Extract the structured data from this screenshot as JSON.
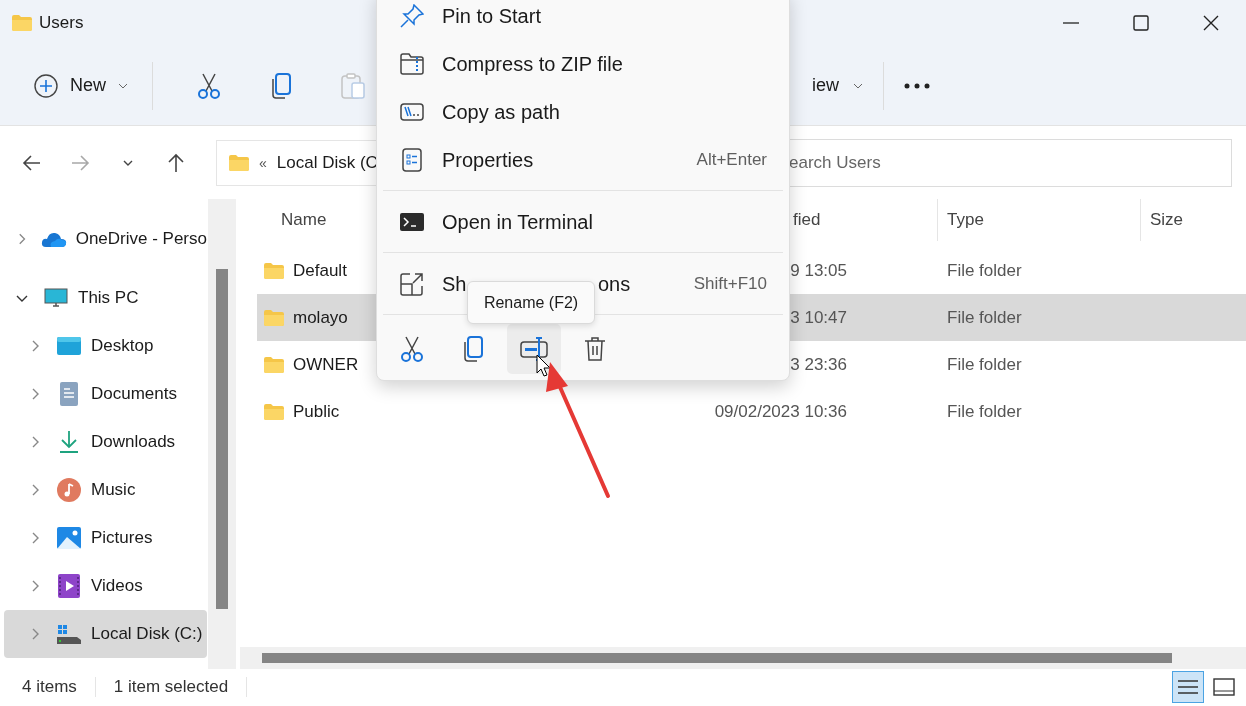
{
  "window": {
    "title": "Users"
  },
  "toolbar": {
    "new_label": "New",
    "actions": [
      {
        "kind": "cut",
        "disabled": false
      },
      {
        "kind": "copy",
        "disabled": false
      },
      {
        "kind": "paste",
        "disabled": true
      }
    ],
    "view_label": "iew"
  },
  "nav": {
    "buttons": [
      {
        "kind": "back",
        "disabled": false
      },
      {
        "kind": "forward",
        "disabled": true
      },
      {
        "kind": "recent",
        "disabled": false
      },
      {
        "kind": "up",
        "disabled": false
      }
    ],
    "overflow": "«",
    "address": "Local Disk (C",
    "search_placeholder": "earch Users"
  },
  "sidebar": {
    "items": [
      {
        "label": "OneDrive - Perso",
        "expanded": false,
        "selected": false
      },
      {
        "label": "This PC",
        "expanded": true,
        "selected": false,
        "children": [
          {
            "label": "Desktop",
            "expanded": false,
            "selected": false
          },
          {
            "label": "Documents",
            "expanded": false,
            "selected": false
          },
          {
            "label": "Downloads",
            "expanded": false,
            "selected": false
          },
          {
            "label": "Music",
            "expanded": false,
            "selected": false
          },
          {
            "label": "Pictures",
            "expanded": false,
            "selected": false
          },
          {
            "label": "Videos",
            "expanded": false,
            "selected": false
          },
          {
            "label": "Local Disk (C:)",
            "expanded": false,
            "selected": true
          }
        ]
      }
    ]
  },
  "file_list": {
    "columns": [
      "Name",
      "fied",
      "Type",
      "Size"
    ],
    "rows": [
      {
        "name": "Default",
        "date": "9 13:05",
        "type": "File folder",
        "selected": false
      },
      {
        "name": "molayo",
        "date": "3 10:47",
        "type": "File folder",
        "selected": true
      },
      {
        "name": "OWNER",
        "date": "3 23:36",
        "type": "File folder",
        "selected": false
      },
      {
        "name": "Public",
        "date": "09/02/2023 10:36",
        "type": "File folder",
        "selected": false
      }
    ]
  },
  "status_bar": {
    "item_count": "4 items",
    "selection": "1 item selected",
    "views": [
      {
        "kind": "details",
        "selected": true
      },
      {
        "kind": "tiles",
        "selected": false
      }
    ]
  },
  "context_menu": {
    "groups": [
      [
        {
          "label": "Pin to Start"
        },
        {
          "label": "Compress to ZIP file"
        },
        {
          "label": "Copy as path"
        },
        {
          "label": "Properties",
          "shortcut": "Alt+Enter"
        }
      ],
      [
        {
          "label": "Open in Terminal"
        }
      ],
      [
        {
          "label": "Sh",
          "label_end": "ons",
          "shortcut": "Shift+F10"
        }
      ]
    ],
    "actions": [
      {
        "kind": "cut",
        "hovered": false
      },
      {
        "kind": "copy",
        "hovered": false
      },
      {
        "kind": "rename",
        "hovered": true
      },
      {
        "kind": "delete",
        "hovered": false
      }
    ],
    "tooltip": "Rename (F2)"
  }
}
